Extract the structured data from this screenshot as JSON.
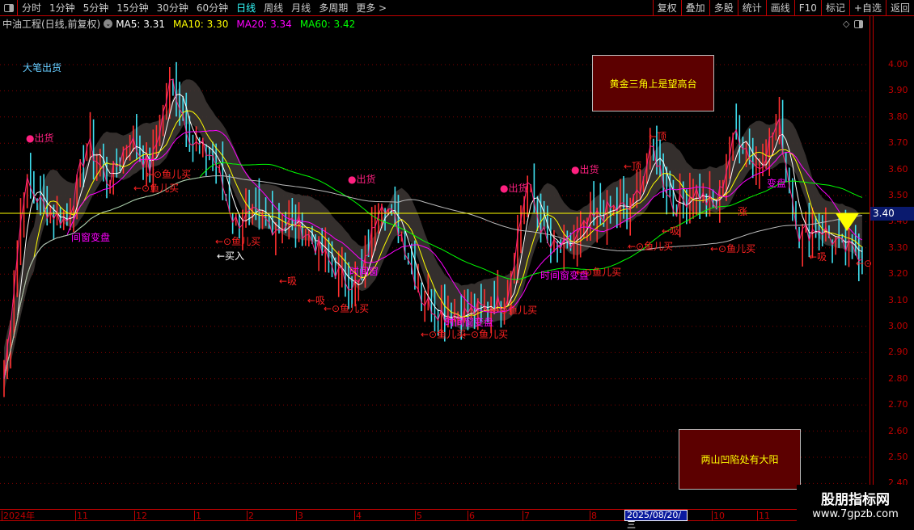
{
  "toolbar": {
    "tabs": [
      "分时",
      "1分钟",
      "5分钟",
      "15分钟",
      "30分钟",
      "60分钟",
      "日线",
      "周线",
      "月线",
      "多周期",
      "更多 >"
    ],
    "active": "日线",
    "buttons": [
      "复权",
      "叠加",
      "多股",
      "统计",
      "画线",
      "F10",
      "标记",
      "+自选",
      "返回"
    ]
  },
  "info": {
    "title": "中油工程(日线,前复权)",
    "ma5": "MA5: 3.31",
    "ma10": "MA10: 3.30",
    "ma20": "MA20: 3.34",
    "ma60": "MA60: 3.42"
  },
  "colors": {
    "up": "#ff3030",
    "down": "#40e0f0",
    "ma5": "#ffffff",
    "ma10": "#ffff00",
    "ma20": "#ff00ff",
    "ma60": "#00ff00",
    "ma120": "#bbbbbb",
    "grid": "#800000",
    "axis": "#c00000"
  },
  "yaxis": {
    "ticks": [
      "4.00",
      "3.90",
      "3.80",
      "3.70",
      "3.60",
      "3.50",
      "3.40",
      "3.30",
      "3.20",
      "3.10",
      "3.00",
      "2.90",
      "2.80",
      "2.70",
      "2.60",
      "2.50",
      "2.40"
    ],
    "current": "3.40"
  },
  "xaxis": {
    "months": [
      "2024年",
      "11",
      "12",
      "1",
      "2",
      "3",
      "4",
      "5",
      "6",
      "7",
      "8",
      "2025/08/20/三",
      "10",
      "11"
    ]
  },
  "price_path": [
    2.8,
    3.55,
    3.45,
    3.4,
    3.7,
    3.55,
    3.72,
    3.6,
    3.95,
    3.7,
    3.65,
    3.4,
    3.42,
    3.38,
    3.4,
    3.3,
    3.2,
    3.15,
    3.5,
    3.35,
    3.1,
    3.05,
    3.05,
    3.07,
    3.1,
    3.55,
    3.3,
    3.3,
    3.4,
    3.45,
    3.45,
    3.68,
    3.45,
    3.52,
    3.45,
    3.75,
    3.6,
    3.78,
    3.35,
    3.38,
    3.3,
    3.28
  ],
  "annotations": [
    "大笔出货",
    "●出货",
    "←⊙鱼儿买",
    "间窗变盘",
    "←⊙鱼儿买",
    "←⊙鱼儿买",
    "←买入",
    "●出货",
    "←吸",
    "←吸",
    "←⊙鱼儿买",
    "时间窗",
    "←⊙鱼儿买",
    "时间窗变盘",
    "←⊙鱼儿买",
    "←⊙鱼儿买",
    "●出货",
    "时间窗变盘",
    "←⊙鱼儿买",
    "←⊙鱼儿买",
    "●出货",
    "←顶",
    "←顶",
    "←吸",
    "涨",
    "变盘",
    "←⊙鱼儿买",
    "←吸",
    "←⊙"
  ],
  "boxes": {
    "golden": "黄金三角上是望高台",
    "valley": "两山凹陷处有大阳"
  },
  "watermark": {
    "name": "股朋指标网",
    "url": "www.7gpzb.com"
  }
}
